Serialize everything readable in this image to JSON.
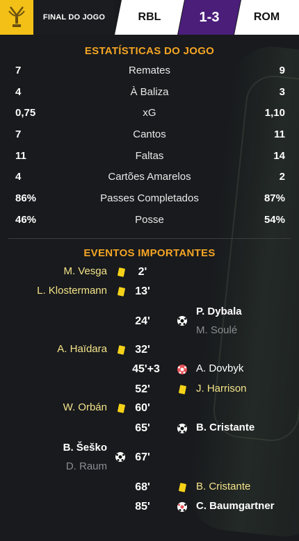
{
  "header": {
    "status": "FINAL DO JOGO",
    "home": "RBL",
    "score": "1-3",
    "away": "ROM",
    "colors": {
      "logo_bg": "#f2c016",
      "score_bg": "#4b1e7a"
    }
  },
  "stats": {
    "title": "ESTATÍSTICAS DO JOGO",
    "rows": [
      {
        "home": "7",
        "label": "Remates",
        "away": "9"
      },
      {
        "home": "4",
        "label": "À Baliza",
        "away": "3"
      },
      {
        "home": "0,75",
        "label": "xG",
        "away": "1,10"
      },
      {
        "home": "7",
        "label": "Cantos",
        "away": "11"
      },
      {
        "home": "11",
        "label": "Faltas",
        "away": "14"
      },
      {
        "home": "4",
        "label": "Cartões Amarelos",
        "away": "2"
      },
      {
        "home": "86%",
        "label": "Passes Completados",
        "away": "87%"
      },
      {
        "home": "46%",
        "label": "Posse",
        "away": "54%"
      }
    ]
  },
  "events": {
    "title": "EVENTOS IMPORTANTES",
    "items": [
      {
        "minute": "2'",
        "side": "home",
        "type": "yellow-card",
        "player": "M. Vesga"
      },
      {
        "minute": "13'",
        "side": "home",
        "type": "yellow-card",
        "player": "L. Klostermann"
      },
      {
        "minute": "24'",
        "side": "away",
        "type": "goal",
        "player": "P. Dybala",
        "assist": "M. Soulé"
      },
      {
        "minute": "32'",
        "side": "home",
        "type": "yellow-card",
        "player": "A. Haïdara"
      },
      {
        "minute": "45'+3",
        "side": "away",
        "type": "penalty-goal",
        "player": "A. Dovbyk"
      },
      {
        "minute": "52'",
        "side": "away",
        "type": "yellow-card",
        "player": "J. Harrison"
      },
      {
        "minute": "60'",
        "side": "home",
        "type": "yellow-card",
        "player": "W. Orbán"
      },
      {
        "minute": "65'",
        "side": "away",
        "type": "goal",
        "player": "B. Cristante"
      },
      {
        "minute": "67'",
        "side": "home",
        "type": "goal",
        "player": "B. Šeško",
        "assist": "D. Raum"
      },
      {
        "minute": "68'",
        "side": "away",
        "type": "yellow-card",
        "player": "B. Cristante"
      },
      {
        "minute": "85'",
        "side": "away",
        "type": "penalty-goal",
        "player": "C. Baumgartner"
      }
    ]
  }
}
